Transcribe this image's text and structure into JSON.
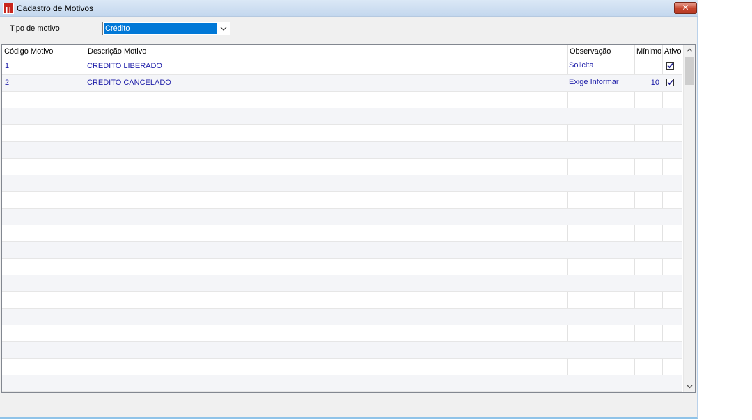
{
  "window": {
    "title": "Cadastro de Motivos",
    "close_label": "✕",
    "icon": "app-logo-icon"
  },
  "filter": {
    "label": "Tipo de motivo",
    "selected": "Crédito"
  },
  "grid": {
    "columns": [
      "Código Motivo",
      "Descrição Motivo",
      "Observação",
      "Mínimo",
      "Ativo"
    ],
    "rows": [
      {
        "codigo": "1",
        "descricao": "CREDITO LIBERADO",
        "observacao": "Solicita",
        "minimo": "",
        "ativo": true
      },
      {
        "codigo": "2",
        "descricao": "CREDITO CANCELADO",
        "observacao": "Exige Informar",
        "minimo": "10",
        "ativo": true
      }
    ]
  },
  "colors": {
    "cell_text": "#1c1ca8",
    "selection": "#0078d7"
  }
}
